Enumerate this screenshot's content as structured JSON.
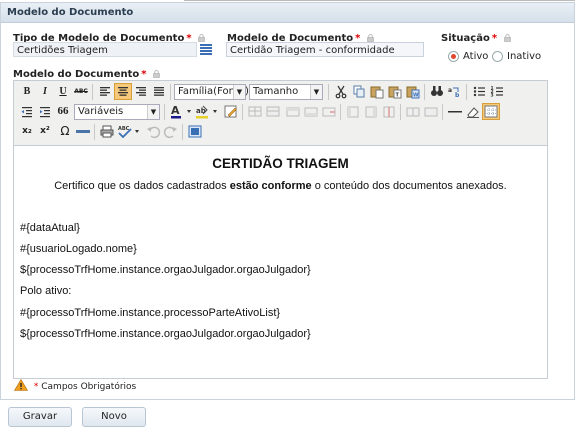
{
  "panel": {
    "title": "Modelo do Documento"
  },
  "fields": {
    "tipo": {
      "label": "Tipo de Modelo de Documento",
      "required": "*",
      "value": "Certidões Triagem"
    },
    "modelo": {
      "label": "Modelo de Documento",
      "required": "*",
      "value": "Certidão Triagem - conformidade"
    },
    "situacao": {
      "label": "Situação",
      "required": "*",
      "options": [
        {
          "label": "Ativo",
          "selected": true
        },
        {
          "label": "Inativo",
          "selected": false
        }
      ]
    },
    "conteudo": {
      "label": "Modelo do Documento",
      "required": "*"
    }
  },
  "toolbar": {
    "family_select": "Família(Fonte)",
    "size_select": "Tamanho",
    "variables_select": "Variáveis",
    "bold": "B",
    "italic": "I",
    "underline": "U",
    "strike": "ABC",
    "subscript": "x₂",
    "superscript": "x²",
    "omega": "Ω",
    "quote": "66"
  },
  "document": {
    "title": "CERTIDÃO TRIAGEM",
    "intro_pre": "Certifico que os dados cadastrados ",
    "intro_bold": "estão conforme",
    "intro_post": " o conteúdo dos documentos anexados.",
    "lines": [
      "#{dataAtual}",
      "#{usuarioLogado.nome}",
      "${processoTrfHome.instance.orgaoJulgador.orgaoJulgador}",
      "Polo ativo:",
      "#{processoTrfHome.instance.processoParteAtivoList}",
      "${processoTrfHome.instance.orgaoJulgador.orgaoJulgador}"
    ]
  },
  "footer": {
    "required_note": "Campos Obrigatórios",
    "required_star": "*"
  },
  "buttons": {
    "save": "Gravar",
    "new": "Novo"
  }
}
